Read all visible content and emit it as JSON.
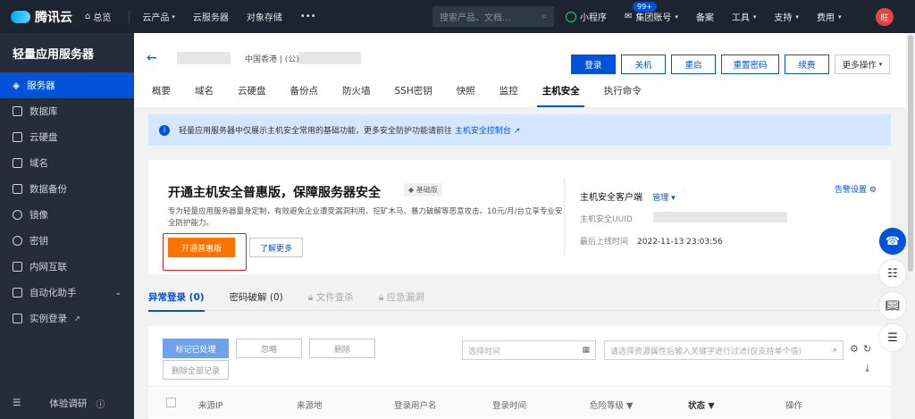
{
  "topnav": {
    "brand": "腾讯云",
    "overview": "总览",
    "cloud_products": "云产品",
    "lighthouse": "云服务器",
    "cos": "对象存储",
    "more": "•••",
    "search_placeholder": "搜索产品、文档...",
    "miniprogram": "小程序",
    "badge": "99+",
    "group_account": "集团账号",
    "beian": "备案",
    "tools": "工具",
    "support": "支持",
    "billing": "费用",
    "avatar": "旺"
  },
  "sidebar": {
    "title": "轻量应用服务器",
    "items": [
      {
        "label": "服务器",
        "icon": "cube-icon"
      },
      {
        "label": "数据库",
        "icon": "database-icon"
      },
      {
        "label": "云硬盘",
        "icon": "disk-icon"
      },
      {
        "label": "域名",
        "icon": "domain-icon"
      },
      {
        "label": "数据备份",
        "icon": "backup-icon"
      },
      {
        "label": "镜像",
        "icon": "image-icon"
      },
      {
        "label": "密钥",
        "icon": "key-icon"
      },
      {
        "label": "内网互联",
        "icon": "network-icon"
      },
      {
        "label": "自动化助手",
        "icon": "automation-icon"
      },
      {
        "label": "实例登录",
        "icon": "terminal-icon"
      }
    ],
    "bottom": "体验调研"
  },
  "header": {
    "region": "中国香港 | (公)",
    "buttons": {
      "login": "登录",
      "shutdown": "关机",
      "restart": "重启",
      "reset_pwd": "重置密码",
      "renew": "续费",
      "more_ops": "更多操作"
    },
    "tabs": [
      "概要",
      "域名",
      "云硬盘",
      "备份点",
      "防火墙",
      "SSH密钥",
      "快照",
      "监控",
      "主机安全",
      "执行命令"
    ],
    "active_tab": "主机安全"
  },
  "info": {
    "text": "轻量应用服务器中仅展示主机安全常用的基础功能，更多安全防护功能请前往",
    "link": "主机安全控制台"
  },
  "promo": {
    "title": "开通主机安全普惠版，保障服务器安全",
    "tag": "基础版",
    "desc": "专为轻量应用服务器量身定制，有效避免企业遭受漏洞利用、挖矿木马、暴力破解等恶意攻击。10元/月/台立享专业安全防护能力。",
    "open_btn": "开通普惠版",
    "learn_btn": "了解更多",
    "client_label": "主机安全客户端",
    "manage": "管理",
    "alarm": "告警设置",
    "uuid_label": "主机安全UUID",
    "last_online_label": "最后上线时间",
    "last_online": "2022-11-13 23:03:56"
  },
  "subtabs": [
    {
      "label": "异常登录 (0)",
      "state": "active"
    },
    {
      "label": "密码破解 (0)",
      "state": "normal"
    },
    {
      "label": "文件查杀",
      "state": "disabled"
    },
    {
      "label": "应急漏洞",
      "state": "disabled"
    }
  ],
  "toolbar": {
    "mark_handled": "标记已处理",
    "ignore": "忽略",
    "delete": "删除",
    "delete_all": "删除全部记录",
    "time_placeholder": "选择时间",
    "filter_placeholder": "请选择资源属性后输入关键字进行过滤(仅支持单个值)"
  },
  "table": {
    "columns": [
      "来源IP",
      "来源地",
      "登录用户名",
      "登录时间",
      "危险等级",
      "状态",
      "操作"
    ]
  }
}
